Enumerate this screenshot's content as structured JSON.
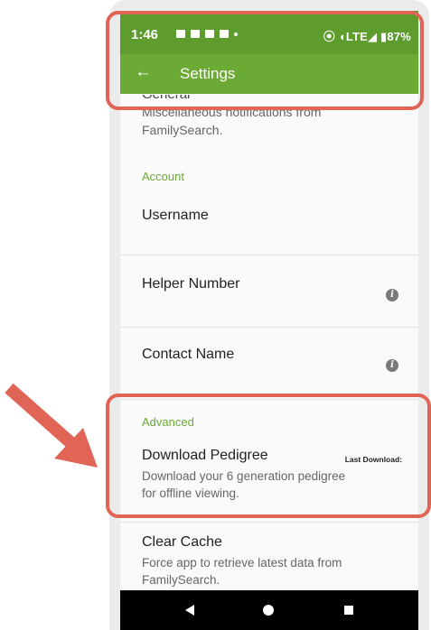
{
  "status_bar": {
    "time": "1:46",
    "right": "⦿ ◖LTE◢ ▮87%"
  },
  "toolbar": {
    "title": "Settings"
  },
  "general": {
    "title": "General",
    "description": "Miscellaneous notifications from FamilySearch."
  },
  "account": {
    "header": "Account",
    "items": [
      {
        "title": "Username"
      },
      {
        "title": "Helper Number",
        "icon": "info-icon"
      },
      {
        "title": "Contact Name",
        "icon": "info-icon"
      }
    ]
  },
  "advanced": {
    "header": "Advanced",
    "download_pedigree": {
      "title": "Download Pedigree",
      "description": "Download your 6 generation pedigree for offline viewing.",
      "last_download_label": "Last Download:"
    }
  },
  "clear_cache": {
    "title": "Clear Cache",
    "description": "Force app to retrieve latest data from FamilySearch."
  },
  "colors": {
    "accent": "#6aaa35",
    "status_bar": "#5e9c2e",
    "annotation": "#e06557"
  }
}
